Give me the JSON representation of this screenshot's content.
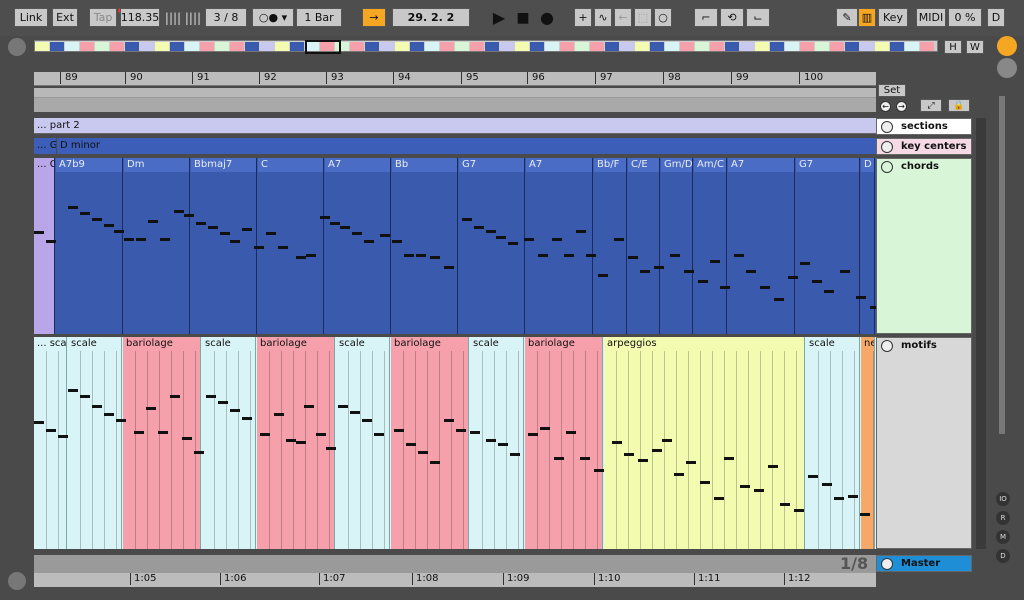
{
  "control_bar": {
    "link": "Link",
    "ext": "Ext",
    "tap": "Tap",
    "tempo": "118.35",
    "time_sig": "3 / 8",
    "quantize": "1 Bar",
    "position": "29.  2.  2",
    "key": "Key",
    "midi": "MIDI",
    "cpu": "0 %",
    "d_button": "D"
  },
  "overview": {
    "h_button": "H",
    "w_button": "W"
  },
  "ruler_bars": [
    "89",
    "90",
    "91",
    "92",
    "93",
    "94",
    "95",
    "96",
    "97",
    "98",
    "99",
    "100"
  ],
  "bottom_ruler": [
    "1:05",
    "1:06",
    "1:07",
    "1:08",
    "1:09",
    "1:10",
    "1:11",
    "1:12"
  ],
  "loop_label": "Set",
  "fraction": "1/8",
  "tracks": {
    "sections": {
      "name": "sections",
      "clips": [
        {
          "label": "... part 2"
        }
      ]
    },
    "key_centers": {
      "name": "key centers",
      "clips": [
        {
          "label": "... G"
        },
        {
          "label": "D minor"
        }
      ]
    },
    "chords": {
      "name": "chords",
      "clips": [
        "... G",
        "A7b9",
        "Dm",
        "Bbmaj7",
        "C",
        "A7",
        "Bb",
        "G7",
        "A7",
        "Bb/F",
        "C/E",
        "Gm/D",
        "Am/C",
        "A7",
        "G7",
        "D"
      ]
    },
    "motifs": {
      "name": "motifs",
      "clips": [
        "... sca",
        "scale",
        "bariolage",
        "scale",
        "bariolage",
        "scale",
        "bariolage",
        "scale",
        "bariolage",
        "arpeggios",
        "scale",
        "ne"
      ]
    },
    "master": {
      "name": "Master"
    }
  },
  "mixer_buttons": [
    "IO",
    "R",
    "M",
    "D"
  ],
  "colors": {
    "sections": "#c9c9f0",
    "key_center": "#3d5eb8",
    "chord_clip": "#3a5aae",
    "chords_header": "#d8f5d8",
    "scale": "#d8f4f6",
    "bariolage": "#f5a0ab",
    "arpeggios": "#f2fbb0",
    "master": "#1e8fd6"
  }
}
